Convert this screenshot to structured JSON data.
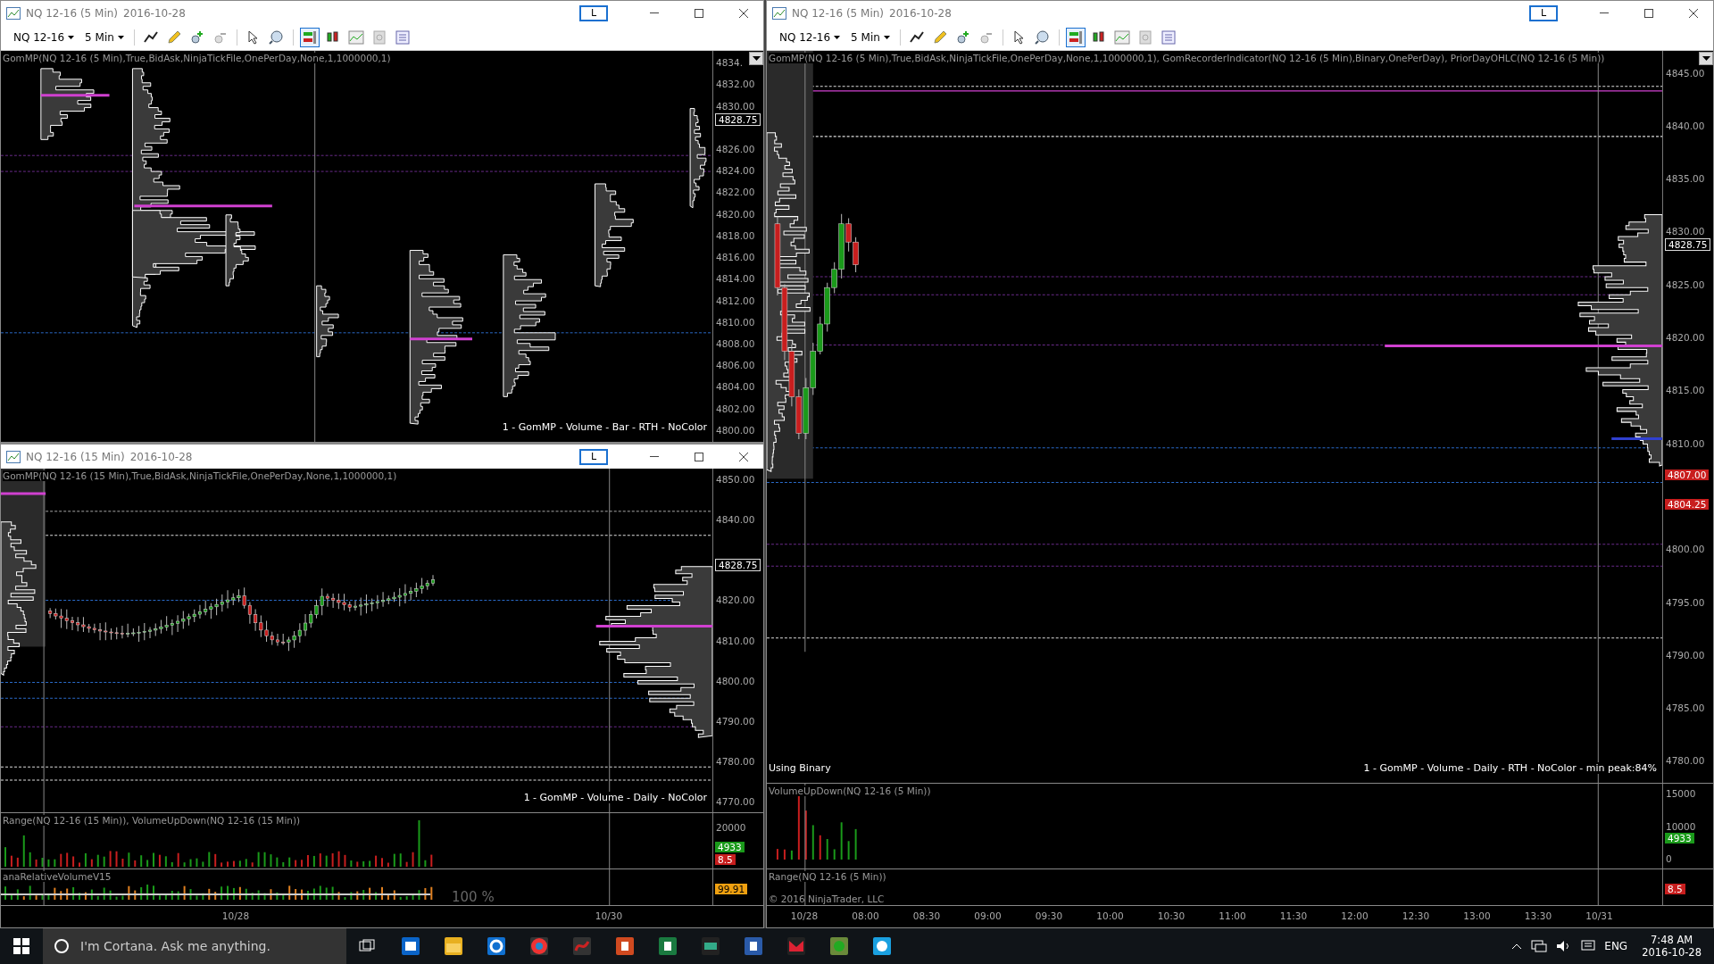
{
  "windows": [
    {
      "title": "NQ 12-16 (5 Min)",
      "date": "2016-10-28",
      "link_button": "L",
      "toolbar": {
        "instrument": "NQ 12-16",
        "interval": "5 Min"
      },
      "panels": [
        {
          "kind": "price",
          "label": "GomMP(NQ 12-16 (5 Min),True,BidAsk,NinjaTickFile,OnePerDay,None,1,1000000,1)",
          "axis": [
            "4834.",
            "4832.00",
            "4830.00",
            "4826.00",
            "4824.00",
            "4822.00",
            "4820.00",
            "4818.00",
            "4816.00",
            "4814.00",
            "4812.00",
            "4810.00",
            "4808.00",
            "4806.00",
            "4804.00",
            "4802.00",
            "4800.00"
          ],
          "badges": [
            {
              "text": "4828.75",
              "kind": "last"
            }
          ],
          "footer": "1 - GomMP - Volume - Bar - RTH - NoColor"
        }
      ]
    },
    {
      "title": "NQ 12-16 (15 Min)",
      "date": "2016-10-28",
      "link_button": "L",
      "panels": [
        {
          "kind": "price",
          "label": "GomMP(NQ 12-16 (15 Min),True,BidAsk,NinjaTickFile,OnePerDay,None,1,1000000,1)",
          "axis": [
            "4850.00",
            "4840.00",
            "4820.00",
            "4810.00",
            "4800.00",
            "4790.00",
            "4780.00",
            "4770.00"
          ],
          "badges": [
            {
              "text": "4828.75",
              "kind": "last"
            }
          ],
          "footer": "1 - GomMP - Volume - Daily - NoColor"
        },
        {
          "kind": "volume",
          "label": "Range(NQ 12-16 (15 Min)), VolumeUpDown(NQ 12-16 (15 Min))",
          "axis": [
            "20000"
          ],
          "badges": [
            {
              "text": "4933",
              "kind": "up"
            },
            {
              "text": "8.5",
              "kind": "down"
            }
          ]
        },
        {
          "kind": "relvol",
          "label": "anaRelativeVolumeV15",
          "note": "100 %",
          "badges": [
            {
              "text": "99.91",
              "kind": "relvol"
            }
          ]
        }
      ],
      "x_axis": [
        "10/28",
        "10/30"
      ]
    },
    {
      "title": "NQ 12-16 (5 Min)",
      "date": "2016-10-28",
      "link_button": "L",
      "toolbar": {
        "instrument": "NQ 12-16",
        "interval": "5 Min"
      },
      "panels": [
        {
          "kind": "price",
          "label": "GomMP(NQ 12-16 (5 Min),True,BidAsk,NinjaTickFile,OnePerDay,None,1,1000000,1), GomRecorderIndicator(NQ 12-16 (5 Min),Binary,OnePerDay), PriorDayOHLC(NQ 12-16 (5 Min))",
          "axis": [
            "4845.00",
            "4840.00",
            "4835.00",
            "4830.00",
            "4825.00",
            "4820.00",
            "4815.00",
            "4810.00",
            "4800.00",
            "4795.00",
            "4790.00",
            "4785.00",
            "4780.00"
          ],
          "badges": [
            {
              "text": "4828.75",
              "kind": "last"
            },
            {
              "text": "4807.00",
              "kind": "down"
            },
            {
              "text": "4804.25",
              "kind": "down"
            }
          ],
          "status": "Using Binary",
          "footer": "1 - GomMP - Volume - Daily - RTH - NoColor - min peak:84%"
        },
        {
          "kind": "volume",
          "label": "VolumeUpDown(NQ 12-16 (5 Min))",
          "axis": [
            "15000",
            "10000",
            "0"
          ],
          "badges": [
            {
              "text": "4933",
              "kind": "up"
            }
          ]
        },
        {
          "kind": "range",
          "label": "Range(NQ 12-16 (5 Min))",
          "copyright": "© 2016 NinjaTrader, LLC",
          "badges": [
            {
              "text": "8.5",
              "kind": "down"
            }
          ]
        }
      ],
      "x_axis": [
        "10/28",
        "08:00",
        "08:30",
        "09:00",
        "09:30",
        "10:00",
        "10:30",
        "11:00",
        "11:30",
        "12:00",
        "12:30",
        "13:00",
        "13:30",
        "10/31"
      ]
    }
  ],
  "taskbar": {
    "search_placeholder": "I'm Cortana. Ask me anything.",
    "language": "ENG",
    "time": "7:48 AM",
    "date": "2016-10-28"
  }
}
